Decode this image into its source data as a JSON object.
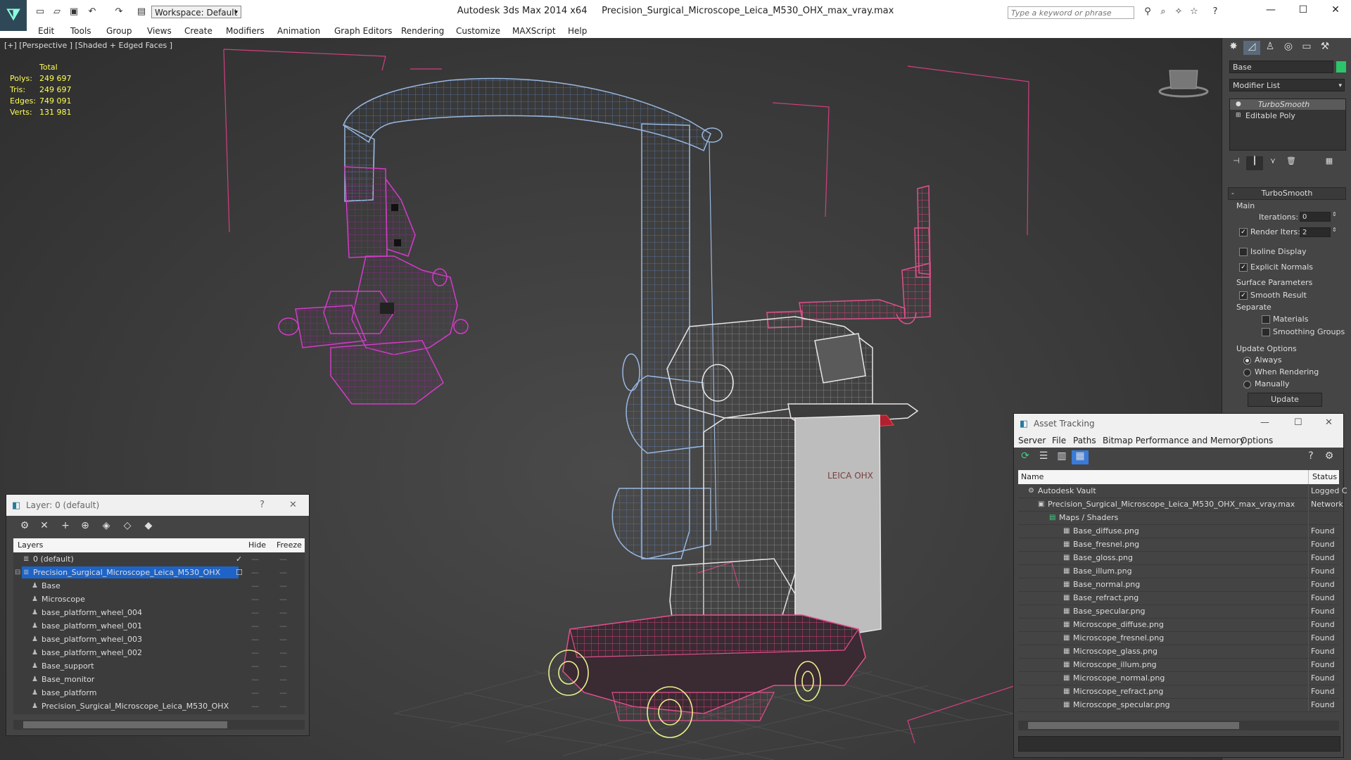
{
  "app": {
    "title": "Autodesk 3ds Max  2014 x64",
    "file": "Precision_Surgical_Microscope_Leica_M530_OHX_max_vray.max",
    "workspace": "Workspace: Default",
    "search_placeholder": "Type a keyword or phrase"
  },
  "menu": [
    "Edit",
    "Tools",
    "Group",
    "Views",
    "Create",
    "Modifiers",
    "Animation",
    "Graph Editors",
    "Rendering",
    "Customize",
    "MAXScript",
    "Help"
  ],
  "viewport": {
    "label": "[+] [Perspective ] [Shaded + Edged Faces ]",
    "stats": {
      "header": "Total",
      "rows": [
        {
          "k": "Polys:",
          "v": "249 697"
        },
        {
          "k": "Tris:",
          "v": "249 697"
        },
        {
          "k": "Edges:",
          "v": "749 091"
        },
        {
          "k": "Verts:",
          "v": "131 981"
        }
      ]
    },
    "brand_text": "LEICA OHX"
  },
  "command_panel": {
    "object_name": "Base",
    "modifier_list": "Modifier List",
    "stack": [
      "TurboSmooth",
      "Editable Poly"
    ],
    "turbosmooth": {
      "title": "TurboSmooth",
      "main": "Main",
      "iterations_label": "Iterations:",
      "iterations": "0",
      "render_iters_label": "Render Iters:",
      "render_iters": "2",
      "isoline": "Isoline Display",
      "explicit": "Explicit Normals",
      "surface": "Surface Parameters",
      "smooth": "Smooth Result",
      "separate": "Separate",
      "materials": "Materials",
      "smoothing_groups": "Smoothing Groups",
      "update_options": "Update Options",
      "always": "Always",
      "when_rendering": "When Rendering",
      "manually": "Manually",
      "update": "Update"
    }
  },
  "layer_dialog": {
    "title": "Layer: 0 (default)",
    "help": "?",
    "close": "✕",
    "col_layers": "Layers",
    "col_hide": "Hide",
    "col_freeze": "Freeze",
    "rows": [
      {
        "name": "0 (default)",
        "level": 1
      },
      {
        "name": "Precision_Surgical_Microscope_Leica_M530_OHX",
        "level": 1,
        "selected": true
      },
      {
        "name": "Base",
        "level": 2
      },
      {
        "name": "Microscope",
        "level": 2
      },
      {
        "name": "base_platform_wheel_004",
        "level": 2
      },
      {
        "name": "base_platform_wheel_001",
        "level": 2
      },
      {
        "name": "base_platform_wheel_003",
        "level": 2
      },
      {
        "name": "base_platform_wheel_002",
        "level": 2
      },
      {
        "name": "Base_support",
        "level": 2
      },
      {
        "name": "Base_monitor",
        "level": 2
      },
      {
        "name": "base_platform",
        "level": 2
      },
      {
        "name": "Precision_Surgical_Microscope_Leica_M530_OHX",
        "level": 2
      }
    ]
  },
  "asset_tracking": {
    "title": "Asset Tracking",
    "menu": [
      "Server",
      "File",
      "Paths",
      "Bitmap Performance and Memory",
      "Options"
    ],
    "col_name": "Name",
    "col_status": "Status",
    "rows": [
      {
        "name": "Autodesk Vault",
        "status": "Logged C",
        "level": 0
      },
      {
        "name": "Precision_Surgical_Microscope_Leica_M530_OHX_max_vray.max",
        "status": "Network",
        "level": 1
      },
      {
        "name": "Maps / Shaders",
        "status": "",
        "level": 2
      },
      {
        "name": "Base_diffuse.png",
        "status": "Found",
        "level": 3
      },
      {
        "name": "Base_fresnel.png",
        "status": "Found",
        "level": 3
      },
      {
        "name": "Base_gloss.png",
        "status": "Found",
        "level": 3
      },
      {
        "name": "Base_illum.png",
        "status": "Found",
        "level": 3
      },
      {
        "name": "Base_normal.png",
        "status": "Found",
        "level": 3
      },
      {
        "name": "Base_refract.png",
        "status": "Found",
        "level": 3
      },
      {
        "name": "Base_specular.png",
        "status": "Found",
        "level": 3
      },
      {
        "name": "Microscope_diffuse.png",
        "status": "Found",
        "level": 3
      },
      {
        "name": "Microscope_fresnel.png",
        "status": "Found",
        "level": 3
      },
      {
        "name": "Microscope_glass.png",
        "status": "Found",
        "level": 3
      },
      {
        "name": "Microscope_illum.png",
        "status": "Found",
        "level": 3
      },
      {
        "name": "Microscope_normal.png",
        "status": "Found",
        "level": 3
      },
      {
        "name": "Microscope_refract.png",
        "status": "Found",
        "level": 3
      },
      {
        "name": "Microscope_specular.png",
        "status": "Found",
        "level": 3
      }
    ]
  },
  "colors": {
    "viewport_bg": "#3b3b3b",
    "wire_blue": "#9ab8e0",
    "wire_magenta": "#d23cc8",
    "wire_white": "#e6e6e6",
    "wire_pink": "#e0508c",
    "wire_yellow": "#e8f08a",
    "stats_yellow": "#ffff55",
    "selection_blue": "#1e64c8"
  }
}
